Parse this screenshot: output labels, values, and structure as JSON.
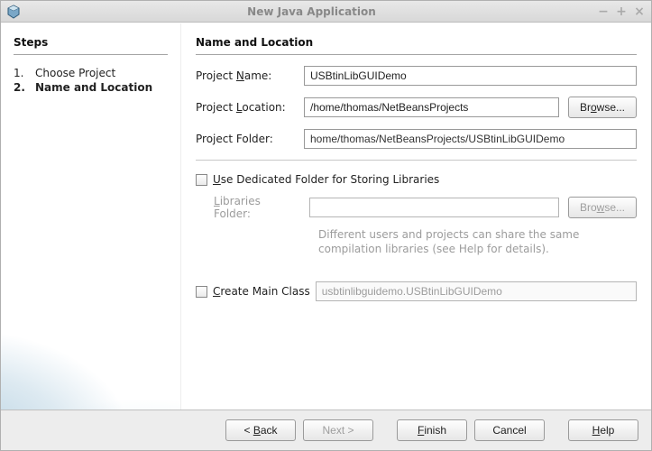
{
  "window": {
    "title": "New Java Application",
    "minimize": "−",
    "maximize": "+",
    "close": "×"
  },
  "sidebar": {
    "heading": "Steps",
    "steps": [
      {
        "num": "1.",
        "label": "Choose Project",
        "current": false
      },
      {
        "num": "2.",
        "label": "Name and Location",
        "current": true
      }
    ]
  },
  "main": {
    "heading": "Name and Location",
    "project_name_label": "Project Name:",
    "project_name_value": "USBtinLibGUIDemo",
    "project_location_label": "Project Location:",
    "project_location_value": "/home/thomas/NetBeansProjects",
    "browse1_label": "Browse...",
    "project_folder_label": "Project Folder:",
    "project_folder_value": "home/thomas/NetBeansProjects/USBtinLibGUIDemo",
    "dedicated_folder_label_pre": "U",
    "dedicated_folder_label_post": "se Dedicated Folder for Storing Libraries",
    "libraries_folder_label": "Libraries Folder:",
    "libraries_folder_value": "",
    "browse2_label": "Browse...",
    "hint_text": "Different users and projects can share the same compilation libraries (see Help for details).",
    "create_main_pre": "C",
    "create_main_post": "reate Main Class",
    "create_main_value": "usbtinlibguidemo.USBtinLibGUIDemo"
  },
  "footer": {
    "back": "< Back",
    "next": "Next >",
    "finish": "Finish",
    "cancel": "Cancel",
    "help": "Help"
  }
}
